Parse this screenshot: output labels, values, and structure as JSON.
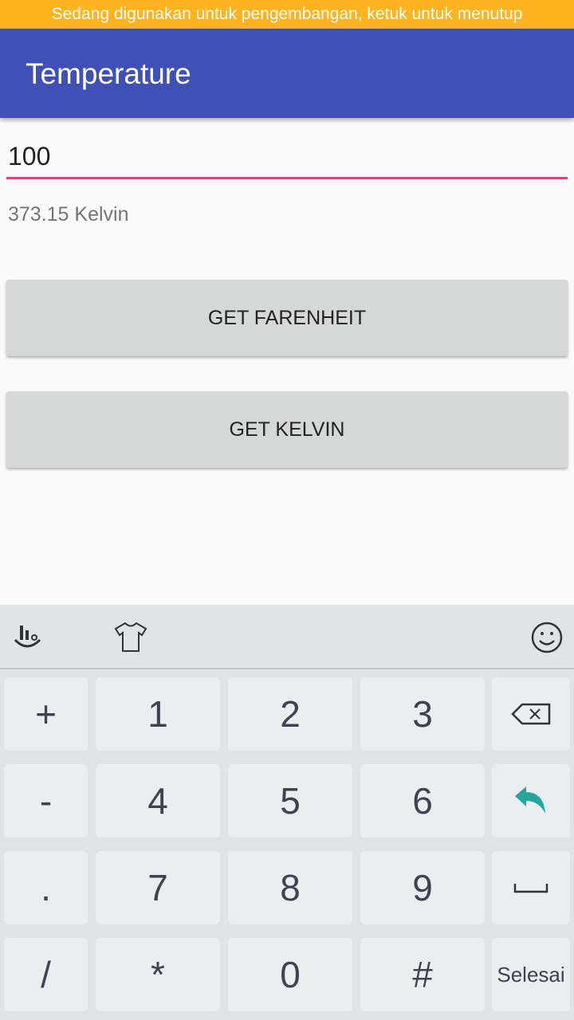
{
  "banner": "Sedang digunakan untuk pengembangan, ketuk untuk menutup",
  "appbar": {
    "title": "Temperature"
  },
  "input": {
    "value": "100"
  },
  "result": "373.15 Kelvin",
  "buttons": {
    "farenheit": "GET FARENHEIT",
    "kelvin": "GET KELVIN"
  },
  "keyboard": {
    "toolbar": [
      "touchpal-logo-icon",
      "theme-shirt-icon",
      "emoji-icon"
    ],
    "rows": [
      [
        "+",
        "1",
        "2",
        "3",
        "backspace-icon"
      ],
      [
        "-",
        "4",
        "5",
        "6",
        "enter-icon"
      ],
      [
        ".",
        "7",
        "8",
        "9",
        "space-icon"
      ],
      [
        "/",
        "*",
        "0",
        "#",
        "Selesai"
      ]
    ],
    "accent": "#26a69a"
  },
  "colors": {
    "appbar": "#3f51b5",
    "banner": "#ffb31f",
    "underline": "#e0457b"
  }
}
